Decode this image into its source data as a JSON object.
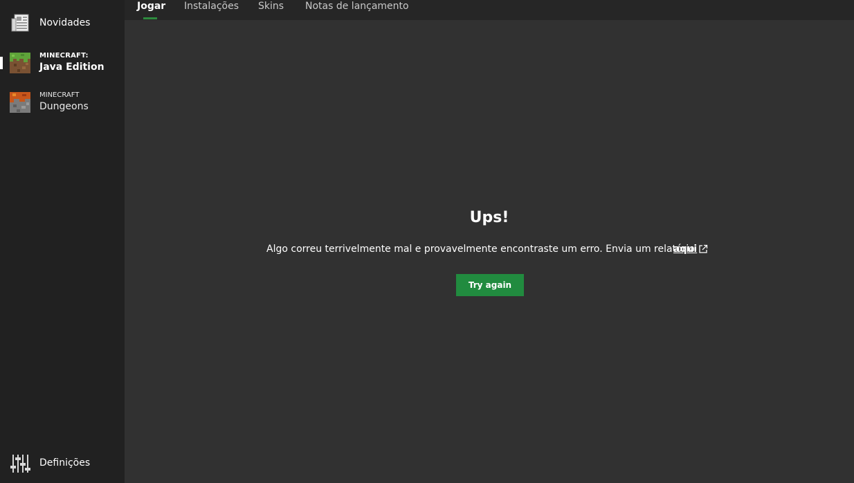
{
  "sidebar": {
    "news_label": "Novidades",
    "java": {
      "small": "MINECRAFT:",
      "big": "Java Edition"
    },
    "dungeons": {
      "small": "MINECRAFT",
      "big": "Dungeons"
    },
    "settings_label": "Definições"
  },
  "tabs": [
    {
      "label": "Jogar",
      "active": true
    },
    {
      "label": "Instalações"
    },
    {
      "label": "Skins"
    },
    {
      "label": "Notas de lançamento"
    }
  ],
  "error": {
    "title": "Ups!",
    "message": "Algo correu terrivelmente mal e provavelmente encontraste um erro. Envia um relatório",
    "link_label": "aqui",
    "retry_label": "Try again"
  },
  "icons": {
    "news": "newspaper-icon",
    "java": "grass-block-icon",
    "dungeons": "dungeons-block-icon",
    "settings": "sliders-icon",
    "external": "external-link-icon"
  },
  "colors": {
    "sidebar_bg": "#212121",
    "content_bg": "#313131",
    "tabbar_bg": "#262626",
    "accent_green": "#218b3f"
  }
}
